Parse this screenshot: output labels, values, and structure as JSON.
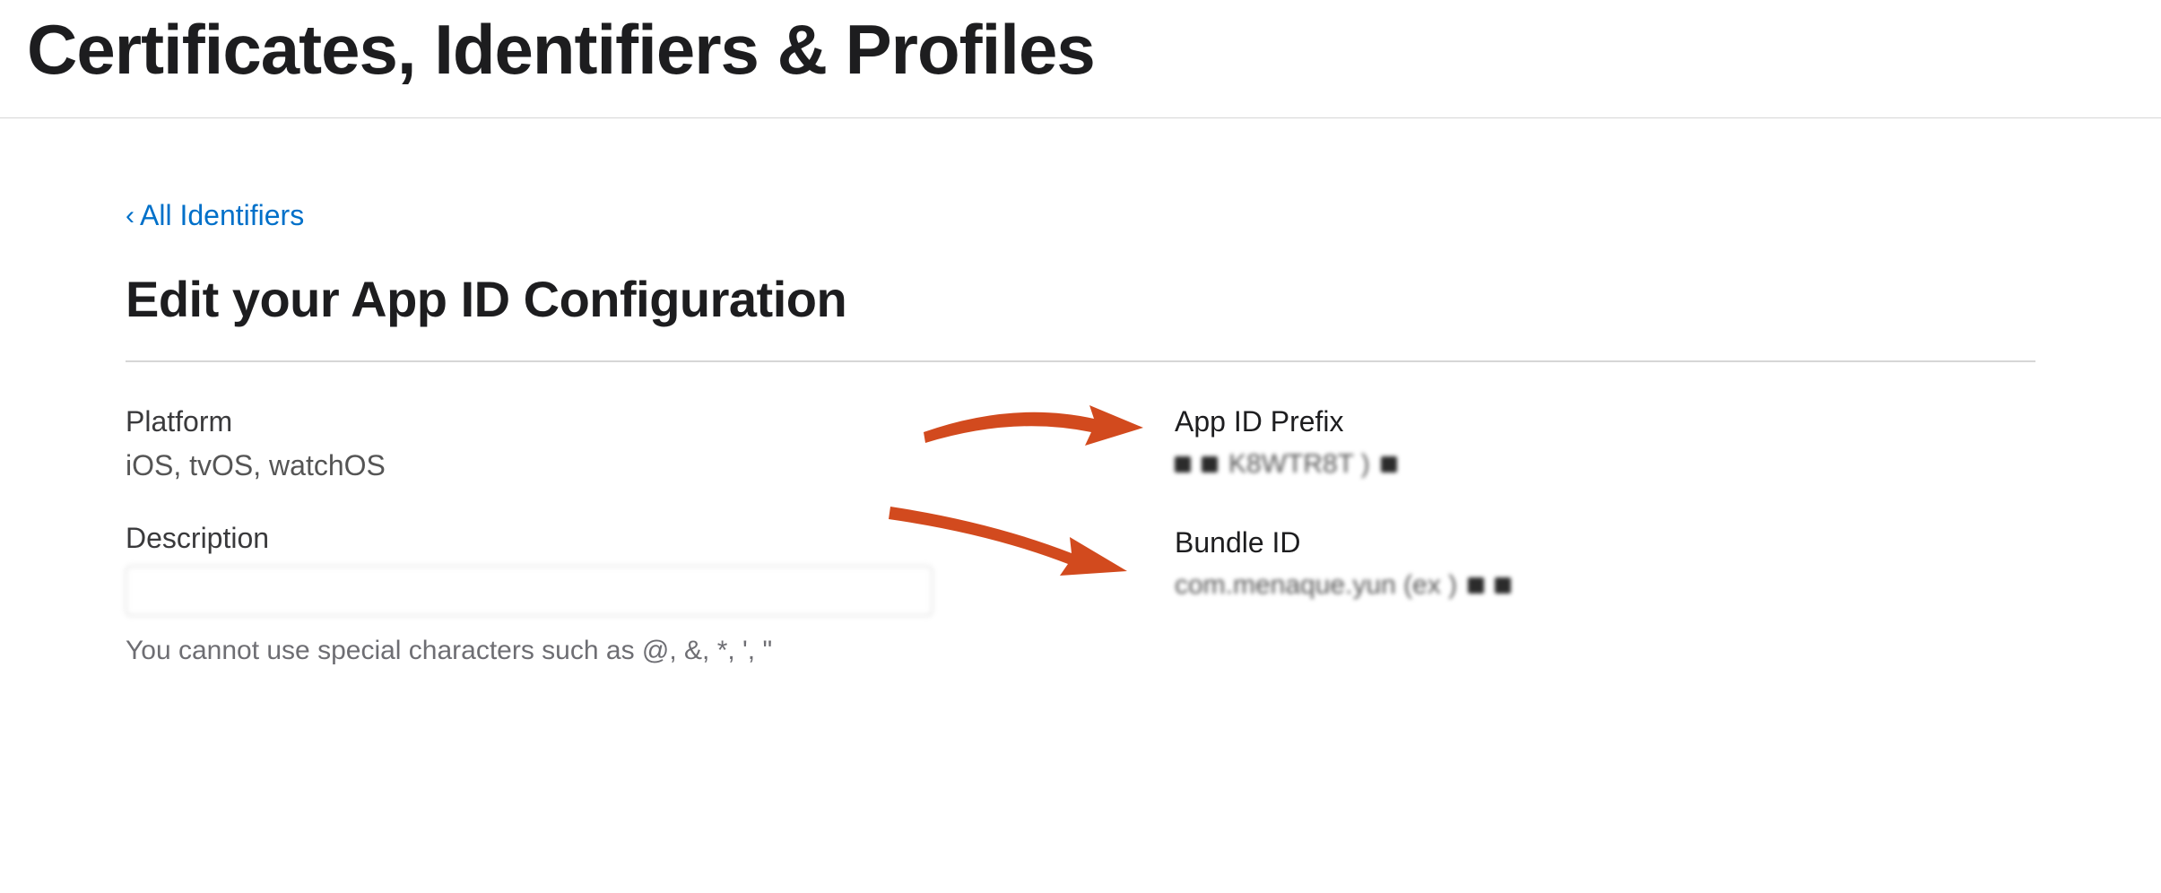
{
  "header": {
    "title": "Certificates, Identifiers & Profiles"
  },
  "nav": {
    "back_caret": "‹",
    "back_label": "All Identifiers"
  },
  "section": {
    "heading": "Edit your App ID Configuration"
  },
  "left": {
    "platform_label": "Platform",
    "platform_value": "iOS, tvOS, watchOS",
    "description_label": "Description",
    "description_value": "",
    "description_helper": "You cannot use special characters such as @, &, *, ', \""
  },
  "right": {
    "prefix_label": "App ID Prefix",
    "prefix_value_redacted": "K8WTR8T        )",
    "bundle_label": "Bundle ID",
    "bundle_value_redacted": "com.menaque.yun          (ex      )"
  },
  "annotation": {
    "arrow_color": "#d24a1e"
  }
}
